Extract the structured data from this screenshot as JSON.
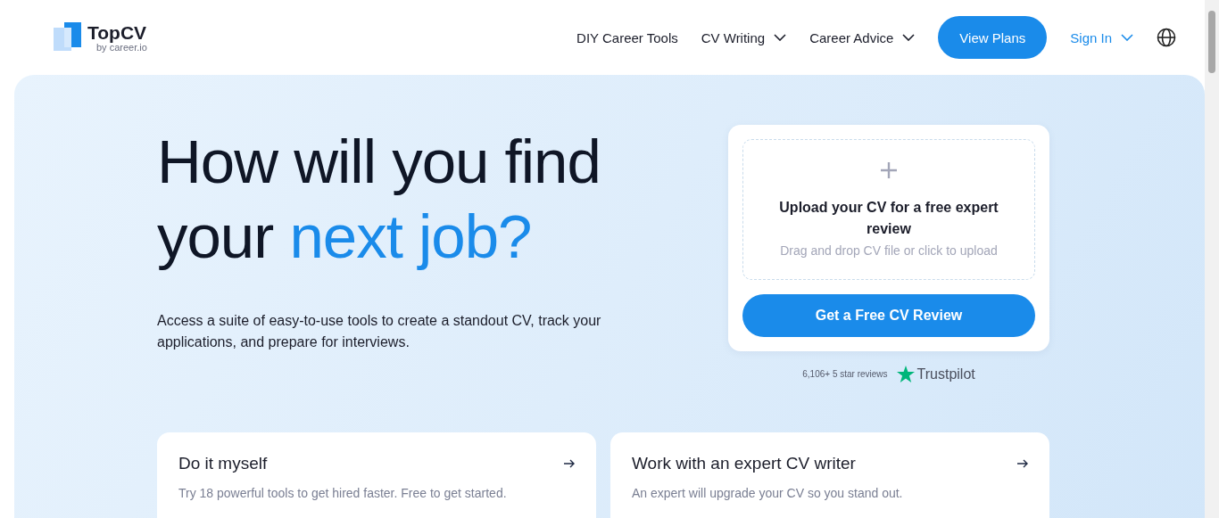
{
  "logo": {
    "name": "TopCV",
    "tagline": "by career.io"
  },
  "nav": [
    {
      "label": "DIY Career Tools",
      "has_menu": false
    },
    {
      "label": "CV Writing",
      "has_menu": true
    },
    {
      "label": "Career Advice",
      "has_menu": true
    }
  ],
  "plans_button": "View Plans",
  "sign_in": {
    "label": "Sign In",
    "has_menu": true
  },
  "hero": {
    "headline": "How will you find your",
    "headline_accent": "next job?",
    "subtitle": "Access a suite of easy-to-use tools to create a standout CV, track your applications, and prepare for interviews."
  },
  "upload_card": {
    "title": "Upload your CV for a free expert review",
    "hint": "Drag and drop CV file or click to upload",
    "button": "Get a Free CV Review"
  },
  "reviews": {
    "count": "6,106+ 5 star reviews",
    "brand": "Trustpilot"
  },
  "options": [
    {
      "title": "Do it myself",
      "description": "Try 18 powerful tools to get hired faster. Free to get started."
    },
    {
      "title": "Work with an expert CV writer",
      "description": "An expert will upgrade your CV so you stand out."
    }
  ]
}
